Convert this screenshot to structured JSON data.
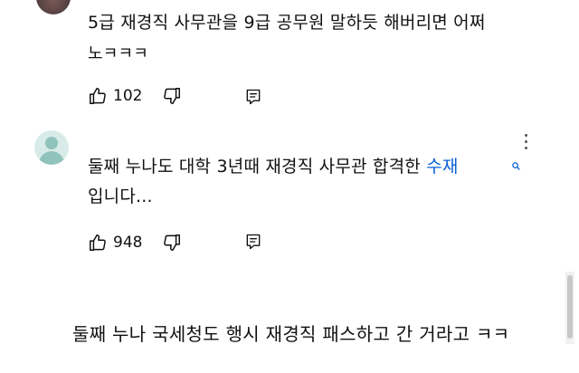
{
  "comment1": {
    "line1": "5급 재경직 사무관을 9급 공무원 말하듯 해버리면 어쩌",
    "line2": "노ㅋㅋㅋ",
    "like_count": "102"
  },
  "comment2": {
    "line1_prefix": "둘째 누나도 대학 3년때 재경직 사무관 합격한 ",
    "line1_link": "수재",
    "line2": "입니다...",
    "like_count": "948"
  },
  "caption": "둘째 누나 국세청도 행시 재경직 패스하고 간 거라고 ㅋㅋ",
  "icons": {
    "like": "thumbs-up-icon",
    "dislike": "thumbs-down-icon",
    "reply": "reply-comment-icon",
    "more": "more-vert-icon",
    "search": "search-icon"
  },
  "colors": {
    "link": "#065fd4",
    "text": "#0f0f0f"
  }
}
